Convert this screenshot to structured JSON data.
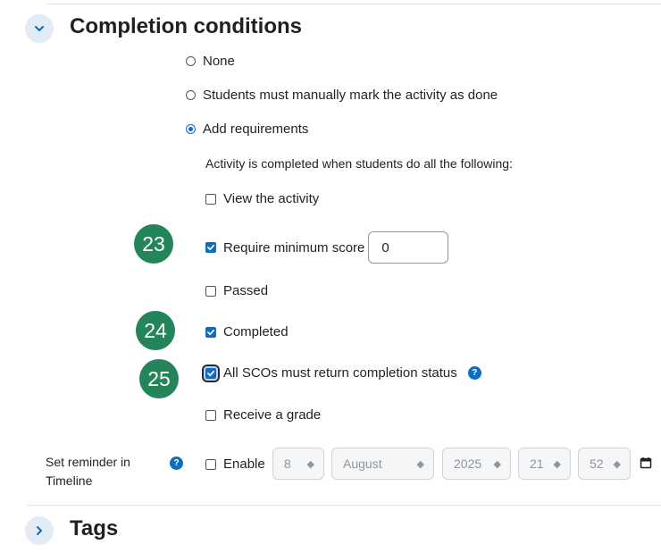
{
  "sections": {
    "completion_title": "Completion conditions",
    "tags_title": "Tags"
  },
  "completion": {
    "radio_none": "None",
    "radio_manual": "Students must manually mark the activity as done",
    "radio_requirements": "Add requirements",
    "selected_radio": "Add requirements",
    "requirements_intro": "Activity is completed when students do all the following:",
    "view_activity": {
      "label": "View the activity",
      "checked": false
    },
    "min_score": {
      "label": "Require minimum score",
      "checked": true,
      "value": "0"
    },
    "passed": {
      "label": "Passed",
      "checked": false
    },
    "completed": {
      "label": "Completed",
      "checked": true
    },
    "all_scos": {
      "label": "All SCOs must return completion status",
      "checked": true
    },
    "receive_grade": {
      "label": "Receive a grade",
      "checked": false
    }
  },
  "badges": [
    "23",
    "24",
    "25"
  ],
  "reminder": {
    "label": "Set reminder in Timeline",
    "help_icon": "?",
    "enable_label": "Enable",
    "enabled": false,
    "day": "8",
    "month": "August",
    "year": "2025",
    "hour": "21",
    "minute": "52"
  },
  "icons": {
    "expanded": "chevron-down-icon",
    "collapsed": "chevron-right-icon",
    "calendar": "calendar-icon",
    "help": "question-circle-icon"
  },
  "colors": {
    "accent": "#0f6cbf",
    "badge": "#25855a",
    "collapse_bg": "#e3ebf7"
  }
}
